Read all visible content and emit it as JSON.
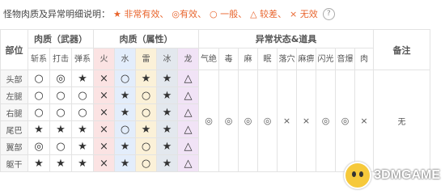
{
  "legend": {
    "label": "怪物肉质及异常明细说明：",
    "items": [
      "★ 非常有效、",
      "◎有效、",
      "○ 一般、",
      "△ 较差、",
      "× 无效"
    ],
    "help": "?"
  },
  "table": {
    "header": {
      "part": "部位",
      "physical_group": "肉质（武器）",
      "elemental_group": "肉质（属性）",
      "ailment_group": "异常状态&道具",
      "note": "备注"
    },
    "physical": [
      "斩系",
      "打击",
      "弹系"
    ],
    "elements": [
      "火",
      "水",
      "雷",
      "冰",
      "龙"
    ],
    "ailments": [
      "气绝",
      "毒",
      "麻",
      "眠",
      "落穴",
      "麻痹",
      "闪光",
      "音爆",
      "肉"
    ],
    "rows": [
      {
        "part": "头部",
        "physical": [
          "○",
          "◎",
          "★"
        ],
        "elemental": [
          "×",
          "○",
          "★",
          "★",
          "△"
        ]
      },
      {
        "part": "左腿",
        "physical": [
          "○",
          "○",
          "○"
        ],
        "elemental": [
          "×",
          "★",
          "○",
          "★",
          "△"
        ]
      },
      {
        "part": "右腿",
        "physical": [
          "○",
          "○",
          "○"
        ],
        "elemental": [
          "×",
          "★",
          "○",
          "★",
          "△"
        ]
      },
      {
        "part": "尾巴",
        "physical": [
          "★",
          "★",
          "★"
        ],
        "elemental": [
          "×",
          "○",
          "★",
          "★",
          "△"
        ]
      },
      {
        "part": "翼部",
        "physical": [
          "◎",
          "○",
          "★"
        ],
        "elemental": [
          "×",
          "★",
          "○",
          "★",
          "△"
        ]
      },
      {
        "part": "躯干",
        "physical": [
          "★",
          "★",
          "★"
        ],
        "elemental": [
          "×",
          "★",
          "○",
          "★",
          "△"
        ]
      }
    ],
    "ailment_values": [
      "◎",
      "◎",
      "◎",
      "◎",
      "×",
      "×",
      "◎",
      "◎",
      "×"
    ],
    "note": "无"
  },
  "watermark": "3DMGAME"
}
